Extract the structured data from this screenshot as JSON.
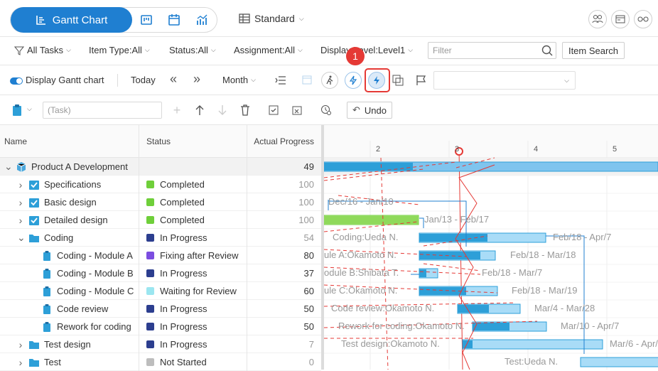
{
  "header": {
    "gantt_chart_label": "Gantt Chart",
    "view_label": "Standard"
  },
  "filters": {
    "all_tasks": "All Tasks",
    "item_type": "Item Type:All",
    "status": "Status:All",
    "assignment": "Assignment:All",
    "display_level": "Display Level:Level1",
    "filter_placeholder": "Filter",
    "item_search": "Item Search"
  },
  "toolbar": {
    "display_gantt": "Display Gantt chart",
    "today": "Today",
    "scale": "Month",
    "badge": "1"
  },
  "task_row": {
    "placeholder": "(Task)",
    "undo": "Undo"
  },
  "colors": {
    "accent": "#1f7fd1",
    "completed": "#6fcf3a",
    "in_progress": "#2c3e8f",
    "fixing": "#7b4de0",
    "waiting": "#9be6f0",
    "not_started": "#bdbdbd",
    "highlight": "#e53935"
  },
  "grid": {
    "headers": [
      "Name",
      "Status",
      "Actual Progress"
    ],
    "rows": [
      {
        "name": "Product A Development",
        "status": "",
        "progress": "49",
        "level": 0,
        "expand": "v",
        "icon": "cube",
        "status_color": ""
      },
      {
        "name": "Specifications",
        "status": "Completed",
        "progress": "100",
        "level": 1,
        "expand": ">",
        "icon": "check",
        "status_color": "#6fcf3a"
      },
      {
        "name": "Basic design",
        "status": "Completed",
        "progress": "100",
        "level": 1,
        "expand": ">",
        "icon": "check",
        "status_color": "#6fcf3a"
      },
      {
        "name": "Detailed design",
        "status": "Completed",
        "progress": "100",
        "level": 1,
        "expand": ">",
        "icon": "check",
        "status_color": "#6fcf3a"
      },
      {
        "name": "Coding",
        "status": "In Progress",
        "progress": "54",
        "level": 1,
        "expand": "v",
        "icon": "folder",
        "status_color": "#2c3e8f"
      },
      {
        "name": "Coding - Module A",
        "status": "Fixing after Review",
        "progress": "80",
        "level": 2,
        "expand": "",
        "icon": "clip",
        "status_color": "#7b4de0"
      },
      {
        "name": "Coding - Module B",
        "status": "In Progress",
        "progress": "37",
        "level": 2,
        "expand": "",
        "icon": "clip",
        "status_color": "#2c3e8f"
      },
      {
        "name": "Coding - Module C",
        "status": "Waiting for Review",
        "progress": "60",
        "level": 2,
        "expand": "",
        "icon": "clip",
        "status_color": "#9be6f0"
      },
      {
        "name": "Code review",
        "status": "In Progress",
        "progress": "50",
        "level": 2,
        "expand": "",
        "icon": "clip",
        "status_color": "#2c3e8f"
      },
      {
        "name": "Rework for coding",
        "status": "In Progress",
        "progress": "50",
        "level": 2,
        "expand": "",
        "icon": "clip",
        "status_color": "#2c3e8f"
      },
      {
        "name": "Test design",
        "status": "In Progress",
        "progress": "7",
        "level": 1,
        "expand": ">",
        "icon": "folder",
        "status_color": "#2c3e8f"
      },
      {
        "name": "Test",
        "status": "Not Started",
        "progress": "0",
        "level": 1,
        "expand": ">",
        "icon": "folder",
        "status_color": "#bdbdbd"
      }
    ]
  },
  "gantt": {
    "ticks": [
      "2",
      "3",
      "4",
      "5"
    ],
    "labels": [
      "Dec/16 - Jan/10",
      "Jan/13 - Feb/17",
      "Coding:Ueda N.",
      "Feb/18 - Apr/7",
      "ule A:Okamoto N.",
      "Feb/18 - Mar/18",
      "odule B:Shibata T.",
      "Feb/18 - Mar/7",
      "ule C:Okamoto N.",
      "Feb/18 - Mar/19",
      "Code review:Okamoto N.",
      "Mar/4 - Mar/28",
      "Rework for coding:Okamoto N.",
      "Mar/10 - Apr/7",
      "Test design:Okamoto N.",
      "Mar/6 - Apr/",
      "Test:Ueda N."
    ]
  }
}
